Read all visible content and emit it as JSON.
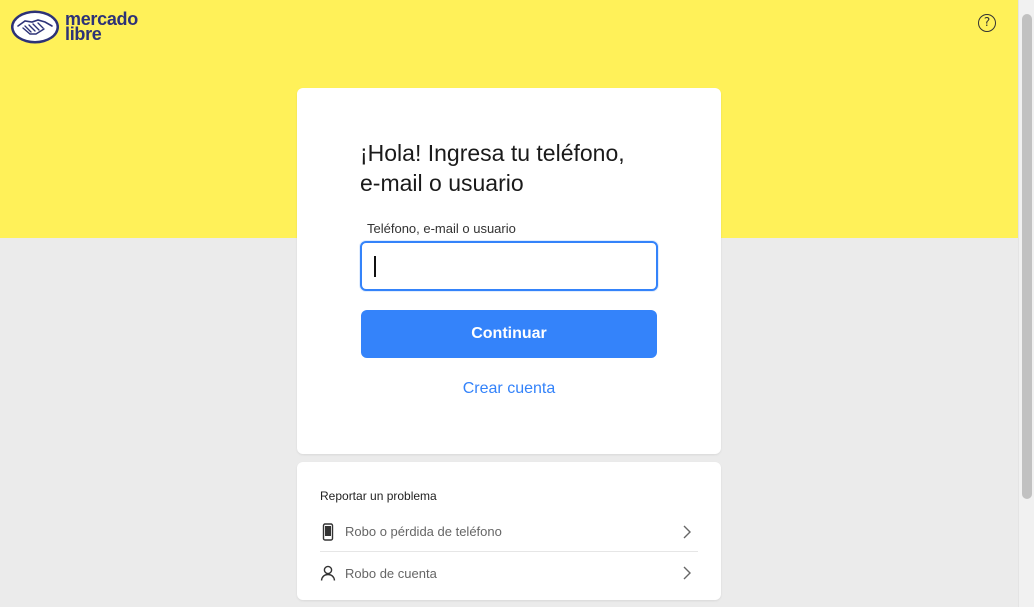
{
  "header": {
    "logo_line1": "mercado",
    "logo_line2": "libre",
    "help_glyph": "?",
    "help_icon": "question-circle-icon",
    "brand_yellow": "#fff159",
    "brand_navy": "#2d3277"
  },
  "login": {
    "title_line1": "¡Hola! Ingresa tu teléfono,",
    "title_line2": "e-mail o usuario",
    "field_label": "Teléfono, e-mail o usuario",
    "input_value": "",
    "continue_label": "Continuar",
    "create_account_label": "Crear cuenta",
    "accent_color": "#3483fa"
  },
  "problems": {
    "title": "Reportar un problema",
    "items": [
      {
        "label": "Robo o pérdida de teléfono",
        "icon": "phone-icon"
      },
      {
        "label": "Robo de cuenta",
        "icon": "user-icon"
      }
    ]
  }
}
